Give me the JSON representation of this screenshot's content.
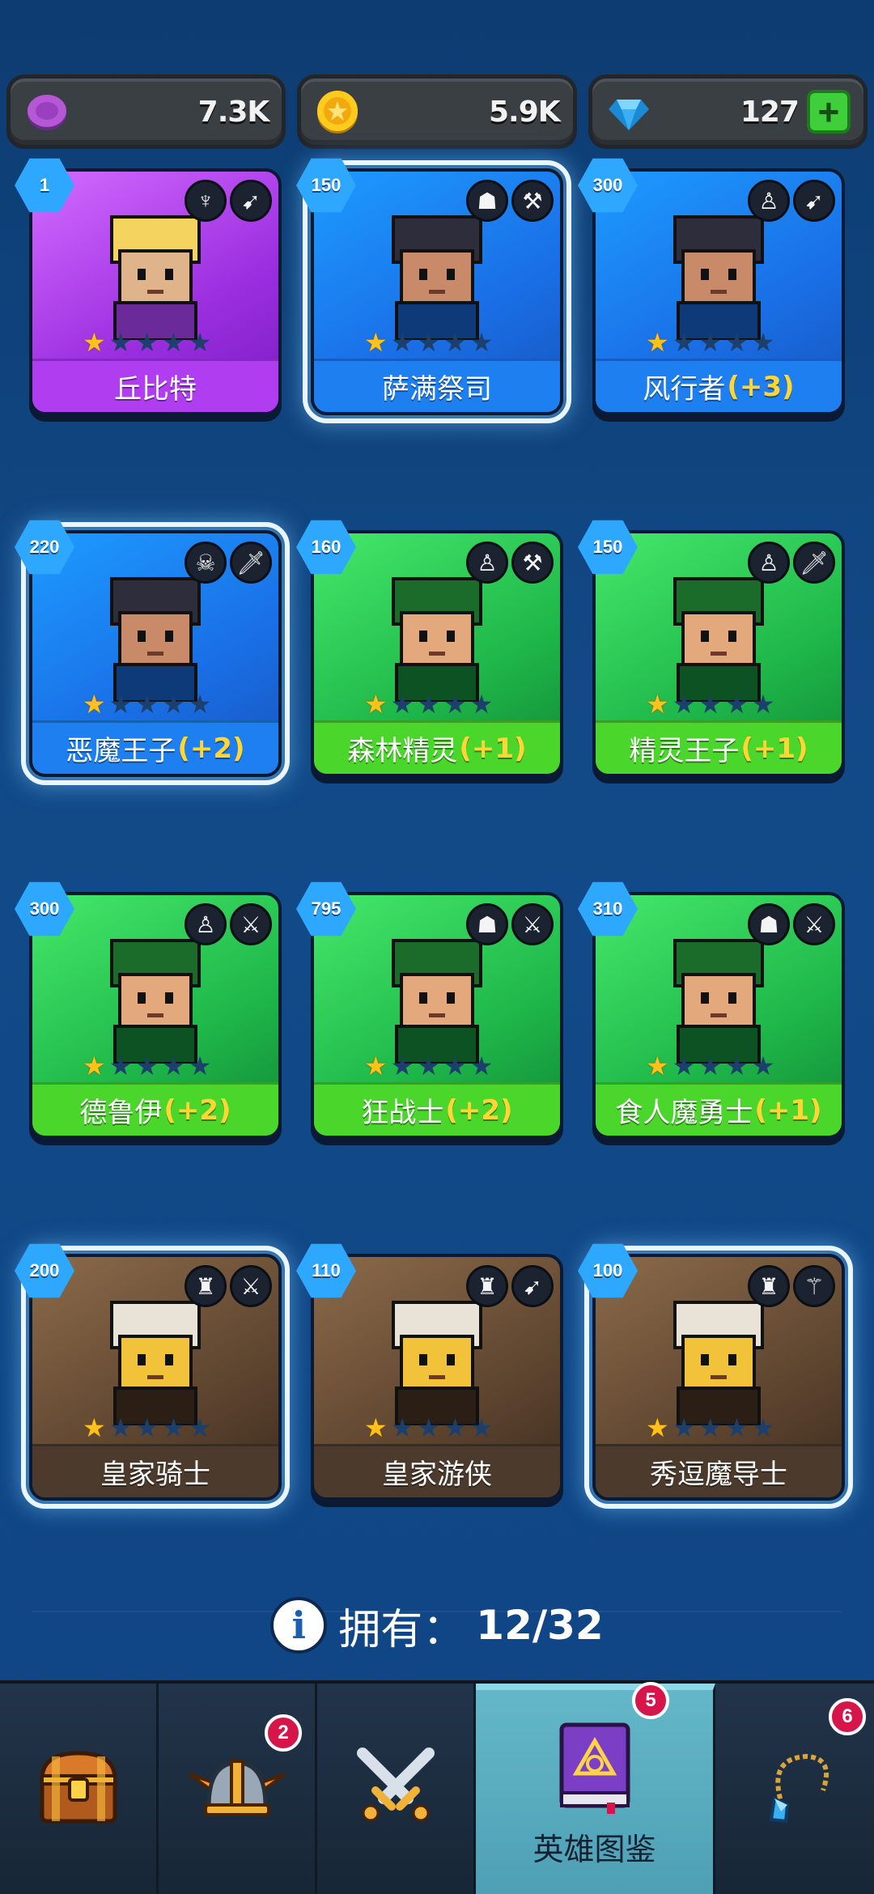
{
  "currency": {
    "coins_purple": "7.3K",
    "coins_gold": "5.9K",
    "gems": "127",
    "add_label": "+"
  },
  "heroes": [
    {
      "cost": "1",
      "name": "丘比特",
      "bonus": "",
      "rarity": "purple",
      "stars": 1,
      "faction_icon": "winged-helmet-icon",
      "weapon_icon": "bow-icon",
      "selected": false
    },
    {
      "cost": "150",
      "name": "萨满祭司",
      "bonus": "",
      "rarity": "blue",
      "stars": 1,
      "faction_icon": "orc-icon",
      "weapon_icon": "hammer-icon",
      "selected": true
    },
    {
      "cost": "300",
      "name": "风行者",
      "bonus": "(+3)",
      "rarity": "blue",
      "stars": 1,
      "faction_icon": "elf-icon",
      "weapon_icon": "bow-icon",
      "selected": false
    },
    {
      "cost": "220",
      "name": "恶魔王子",
      "bonus": "(+2)",
      "rarity": "blue",
      "stars": 1,
      "faction_icon": "demon-skull-icon",
      "weapon_icon": "dagger-icon",
      "selected": true
    },
    {
      "cost": "160",
      "name": "森林精灵",
      "bonus": "(+1)",
      "rarity": "green",
      "stars": 1,
      "faction_icon": "elf-icon",
      "weapon_icon": "hammer-icon",
      "selected": false
    },
    {
      "cost": "150",
      "name": "精灵王子",
      "bonus": "(+1)",
      "rarity": "green",
      "stars": 1,
      "faction_icon": "elf-icon",
      "weapon_icon": "dagger-icon",
      "selected": false
    },
    {
      "cost": "300",
      "name": "德鲁伊",
      "bonus": "(+2)",
      "rarity": "green",
      "stars": 1,
      "faction_icon": "elf-icon",
      "weapon_icon": "sword-icon",
      "selected": false
    },
    {
      "cost": "795",
      "name": "狂战士",
      "bonus": "(+2)",
      "rarity": "green",
      "stars": 1,
      "faction_icon": "orc-icon",
      "weapon_icon": "sword-icon",
      "selected": false
    },
    {
      "cost": "310",
      "name": "食人魔勇士",
      "bonus": "(+1)",
      "rarity": "green",
      "stars": 1,
      "faction_icon": "orc-icon",
      "weapon_icon": "sword-icon",
      "selected": false
    },
    {
      "cost": "200",
      "name": "皇家骑士",
      "bonus": "",
      "rarity": "brown",
      "stars": 1,
      "faction_icon": "knight-helmet-icon",
      "weapon_icon": "sword-icon",
      "selected": true
    },
    {
      "cost": "110",
      "name": "皇家游侠",
      "bonus": "",
      "rarity": "brown",
      "stars": 1,
      "faction_icon": "knight-helmet-icon",
      "weapon_icon": "bow-icon",
      "selected": false
    },
    {
      "cost": "100",
      "name": "秀逗魔导士",
      "bonus": "",
      "rarity": "brown",
      "stars": 1,
      "faction_icon": "knight-helmet-icon",
      "weapon_icon": "staff-icon",
      "selected": true
    }
  ],
  "owned": {
    "label": "拥有：",
    "value": "12/32"
  },
  "nav": [
    {
      "name": "chest",
      "label": "",
      "badge": ""
    },
    {
      "name": "heroes-helmet",
      "label": "",
      "badge": "2"
    },
    {
      "name": "battle",
      "label": "",
      "badge": ""
    },
    {
      "name": "hero-codex",
      "label": "英雄图鉴",
      "badge": "5"
    },
    {
      "name": "amulet",
      "label": "",
      "badge": "6"
    }
  ]
}
